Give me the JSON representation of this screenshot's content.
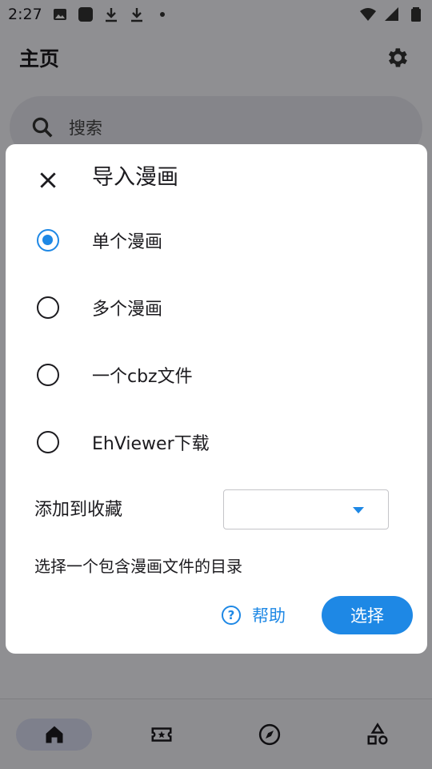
{
  "status_bar": {
    "time": "2:27"
  },
  "app_bar": {
    "title": "主页"
  },
  "search": {
    "placeholder": "搜索"
  },
  "dialog": {
    "title": "导入漫画",
    "options": [
      {
        "label": "单个漫画",
        "selected": true
      },
      {
        "label": "多个漫画",
        "selected": false
      },
      {
        "label": "一个cbz文件",
        "selected": false
      },
      {
        "label": "EhViewer下载",
        "selected": false
      }
    ],
    "favorite_label": "添加到收藏",
    "favorite_value": "",
    "hint": "选择一个包含漫画文件的目录",
    "help_label": "帮助",
    "help_icon": "?",
    "select_label": "选择"
  },
  "bottom_nav": {
    "items": [
      {
        "icon": "home-icon",
        "active": true
      },
      {
        "icon": "ticket-star-icon",
        "active": false
      },
      {
        "icon": "compass-icon",
        "active": false
      },
      {
        "icon": "shapes-icon",
        "active": false
      }
    ]
  },
  "colors": {
    "accent": "#1e88e5",
    "scrim": "rgba(0,0,0,0.42)"
  }
}
